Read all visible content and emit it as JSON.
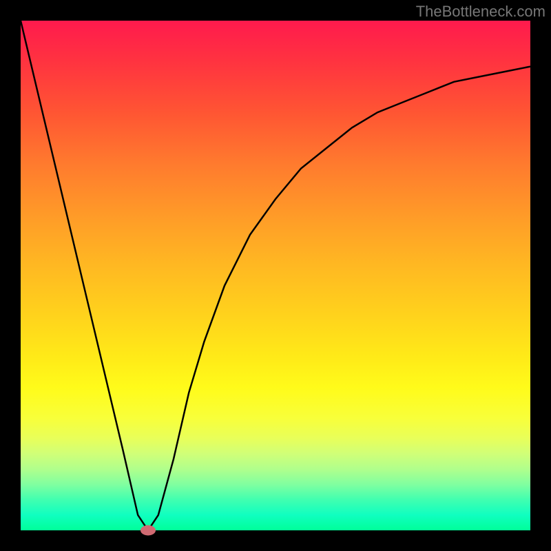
{
  "watermark": "TheBottleneck.com",
  "colors": {
    "background": "#000000",
    "gradient_top": "#ff1a4d",
    "gradient_bottom": "#00ff99",
    "curve": "#000000",
    "marker": "#cf6a72"
  },
  "chart_data": {
    "type": "line",
    "title": "",
    "xlabel": "",
    "ylabel": "",
    "xlim": [
      0,
      100
    ],
    "ylim": [
      0,
      100
    ],
    "series": [
      {
        "name": "bottleneck-curve",
        "x": [
          0,
          5,
          10,
          15,
          20,
          23,
          25,
          27,
          30,
          33,
          36,
          40,
          45,
          50,
          55,
          60,
          65,
          70,
          75,
          80,
          85,
          90,
          95,
          100
        ],
        "y": [
          100,
          79,
          58,
          37,
          16,
          3,
          0,
          3,
          14,
          27,
          37,
          48,
          58,
          65,
          71,
          75,
          79,
          82,
          84,
          86,
          88,
          89,
          90,
          91
        ]
      }
    ],
    "marker": {
      "x": 25,
      "y": 0
    }
  }
}
